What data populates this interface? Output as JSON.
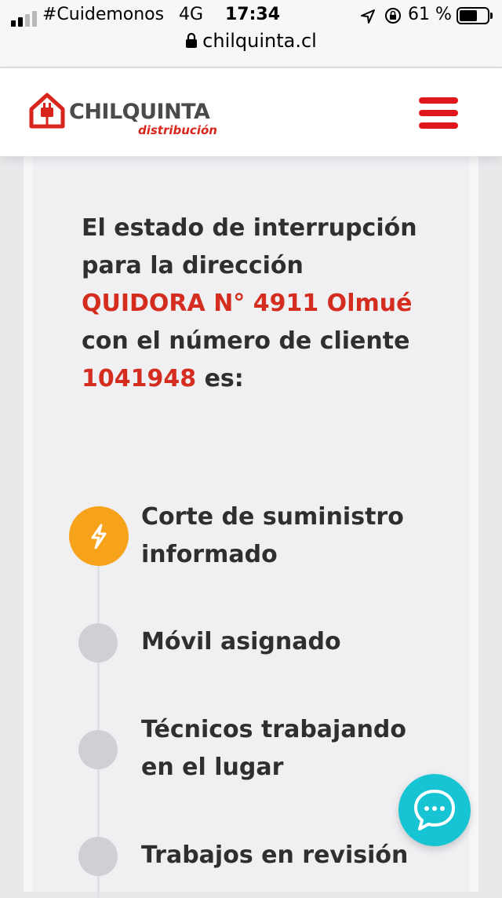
{
  "status_bar": {
    "carrier": "#Cuidemonos",
    "network": "4G",
    "time": "17:34",
    "battery_percent": "61 %",
    "battery_level": 0.61,
    "signal_bars": 2
  },
  "browser": {
    "url": "chilquinta.cl"
  },
  "header": {
    "logo_name": "CHILQUINTA",
    "logo_subtitle": "distribución",
    "brand_color": "#d9261c"
  },
  "status": {
    "line1": "El estado de interrupción",
    "line2": "para la dirección",
    "address": "QUIDORA N° 4911 Olmué",
    "line4": "con el número de cliente",
    "client_number": "1041948",
    "line5_suffix": " es:"
  },
  "timeline": {
    "active_color": "#f7a21b",
    "inactive_color": "#cfcfd4",
    "steps": [
      {
        "label_line1": "Corte de suministro",
        "label_line2": "informado",
        "active": true,
        "icon": "lightning-icon"
      },
      {
        "label_line1": "Móvil asignado",
        "label_line2": "",
        "active": false
      },
      {
        "label_line1": "Técnicos trabajando",
        "label_line2": "en el lugar",
        "active": false
      },
      {
        "label_line1": "Trabajos en revisión",
        "label_line2": "",
        "active": false
      }
    ]
  },
  "chat": {
    "icon": "chat-bubble-icon",
    "color": "#17c4d3"
  }
}
